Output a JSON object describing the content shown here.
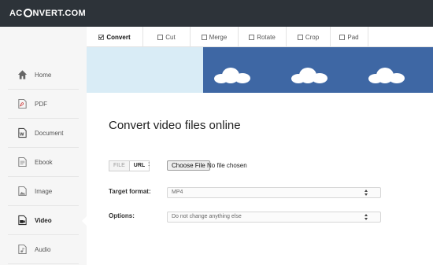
{
  "header": {
    "logo_prefix": "AC",
    "logo_suffix": "NVERT.COM"
  },
  "tabs": [
    {
      "label": "Convert",
      "active": true
    },
    {
      "label": "Cut",
      "active": false
    },
    {
      "label": "Merge",
      "active": false
    },
    {
      "label": "Rotate",
      "active": false
    },
    {
      "label": "Crop",
      "active": false
    },
    {
      "label": "Pad",
      "active": false
    }
  ],
  "sidebar": {
    "items": [
      {
        "label": "Home",
        "icon": "home-icon",
        "active": false
      },
      {
        "label": "PDF",
        "icon": "pdf-icon",
        "active": false
      },
      {
        "label": "Document",
        "icon": "word-document-icon",
        "active": false
      },
      {
        "label": "Ebook",
        "icon": "ebook-icon",
        "active": false
      },
      {
        "label": "Image",
        "icon": "image-icon",
        "active": false
      },
      {
        "label": "Video",
        "icon": "video-icon",
        "active": true
      },
      {
        "label": "Audio",
        "icon": "audio-icon",
        "active": false
      }
    ]
  },
  "main": {
    "title": "Convert video files online",
    "source_toggle": {
      "file_label": "FILE",
      "url_label": "URL",
      "selected": "URL"
    },
    "colon": ":",
    "file_input": {
      "button_label": "Choose File",
      "status": "No file chosen"
    },
    "target_format": {
      "label": "Target format:",
      "value": "MP4"
    },
    "options": {
      "label": "Options:",
      "value": "Do not change anything else"
    }
  },
  "colors": {
    "topbar": "#2d3339",
    "sidebar": "#f6f6f6",
    "banner_left": "#d9ecf6",
    "banner_right": "#3e67a4"
  }
}
